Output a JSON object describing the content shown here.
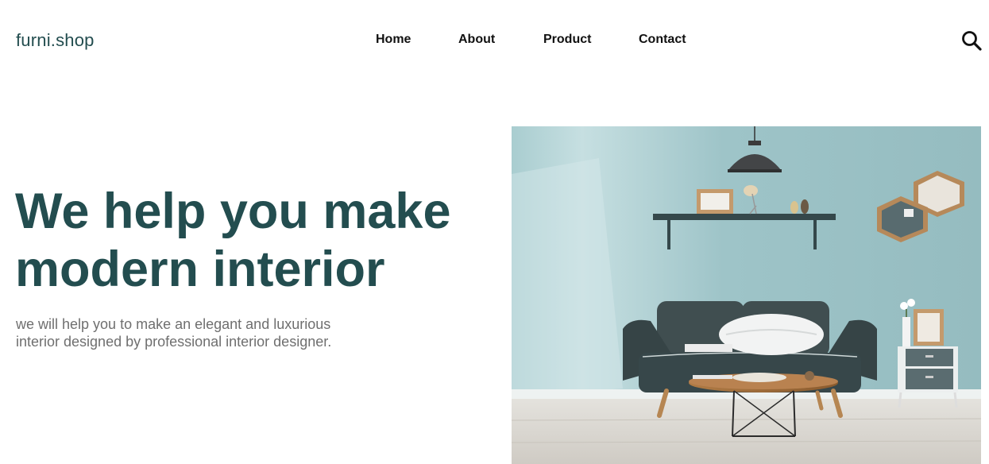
{
  "header": {
    "logo": "furni.shop",
    "nav": [
      {
        "label": "Home"
      },
      {
        "label": "About"
      },
      {
        "label": "Product"
      },
      {
        "label": "Contact"
      }
    ],
    "search_icon": "search-icon"
  },
  "hero": {
    "title_lines": [
      "We help you make",
      "modern interior"
    ],
    "subtitle_lines": [
      "we will help you to make an elegant and luxurious",
      "interior designed by professional interior designer."
    ],
    "image": "living-room-photo"
  },
  "colors": {
    "brand": "#234d4f",
    "nav_text": "#111111",
    "subtitle_text": "#6f6f6f",
    "wall": "#9cc4c8",
    "floor": "#d9d6d0",
    "sofa": "#3c4a4c"
  }
}
